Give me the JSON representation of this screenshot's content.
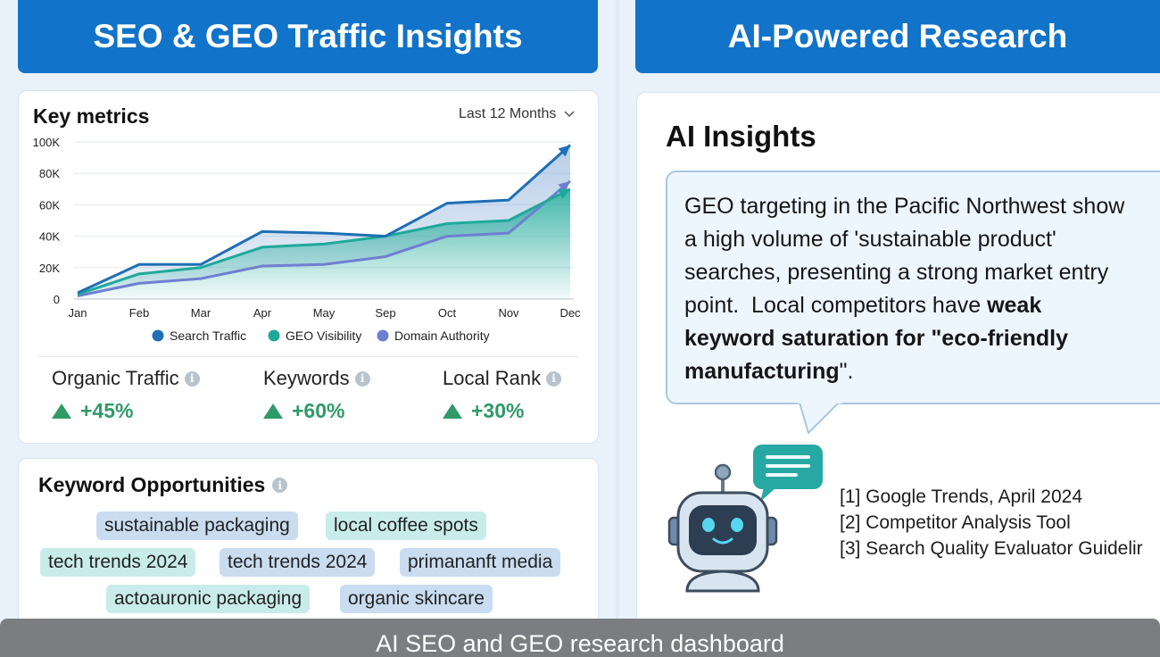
{
  "headers": {
    "left": "SEO & GEO Traffic Insights",
    "right": "AI-Powered Research"
  },
  "key_metrics": {
    "title": "Key metrics",
    "range": "Last 12 Months",
    "metrics": [
      {
        "label": "Organic Traffic",
        "value": "+45%"
      },
      {
        "label": "Keywords",
        "value": "+60%"
      },
      {
        "label": "Local Rank",
        "value": "+30%"
      }
    ]
  },
  "chart_data": {
    "type": "area",
    "x": [
      "Jan",
      "Feb",
      "Mar",
      "Apr",
      "May",
      "Sep",
      "Oct",
      "Nov",
      "Dec"
    ],
    "yticks": [
      "0",
      "20K",
      "40K",
      "60K",
      "80K",
      "100K"
    ],
    "ylim": [
      0,
      100000
    ],
    "grid": true,
    "legend": "bottom",
    "series": [
      {
        "name": "Search Traffic",
        "color": "#1f6fb5",
        "values": [
          4000,
          22000,
          22000,
          43000,
          42000,
          40000,
          61000,
          63000,
          98000
        ]
      },
      {
        "name": "GEO Visibility",
        "color": "#1fa99a",
        "values": [
          3000,
          16000,
          20000,
          33000,
          35000,
          40000,
          48000,
          50000,
          70000
        ]
      },
      {
        "name": "Domain Authority",
        "color": "#6f7fd0",
        "values": [
          2000,
          10000,
          13000,
          21000,
          22000,
          27000,
          40000,
          42000,
          75000
        ]
      }
    ]
  },
  "keyword_opportunities": {
    "title": "Keyword Opportunities",
    "tags": [
      "sustainable packaging",
      "local coffee spots",
      "tech trends 2024",
      "tech trends 2024",
      "primananft media",
      "actoauronic packaging",
      "organic skincare"
    ]
  },
  "ai_insights": {
    "title": "AI Insights",
    "lines": [
      {
        "text": "GEO targeting in the Pacific Northwest show"
      },
      {
        "text": "a high volume of 'sustainable product'"
      },
      {
        "text": "searches, presenting a strong market entry"
      },
      {
        "text": "point.  Local competitors have ",
        "bold": "weak"
      },
      {
        "bold": "keyword saturation for \"eco-friendly"
      },
      {
        "bold": "manufacturing",
        "text": "\"."
      }
    ],
    "references": [
      "[1] Google Trends, April 2024",
      "[2] Competitor Analysis Tool",
      "[3] Search Quality Evaluator Guidelir"
    ]
  },
  "caption": "AI SEO and GEO research dashboard"
}
